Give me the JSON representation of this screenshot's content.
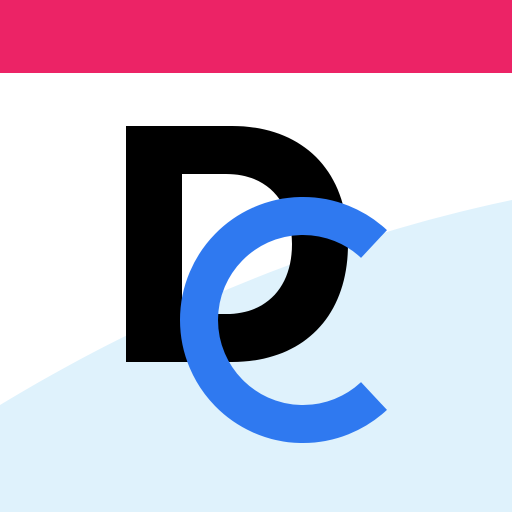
{
  "app_icon": {
    "name": "DC",
    "logo_letters": [
      "D",
      "C"
    ],
    "colors": {
      "top_band": "#EC2366",
      "background": "#FFFFFF",
      "wave": "#DFF2FC",
      "letter_d": "#000000",
      "letter_c": "#2F79F0"
    }
  }
}
